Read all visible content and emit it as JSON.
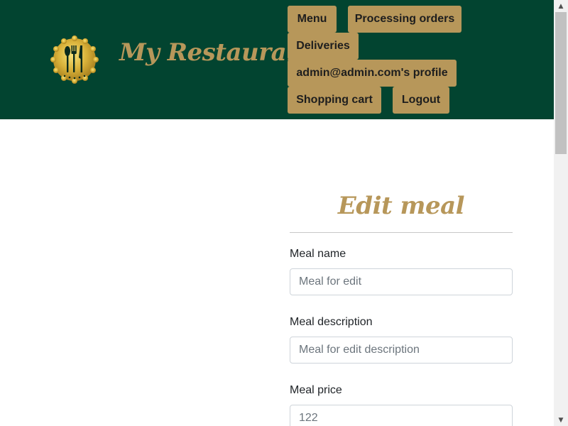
{
  "brand": {
    "name": "My Restaurant"
  },
  "nav": {
    "menu": "Menu",
    "processing_orders": "Processing orders",
    "deliveries": "Deliveries",
    "profile": "admin@admin.com's profile",
    "shopping_cart": "Shopping cart",
    "logout": "Logout"
  },
  "form": {
    "title": "Edit meal",
    "meal_name_label": "Meal name",
    "meal_name_placeholder": "Meal for edit",
    "meal_description_label": "Meal description",
    "meal_description_placeholder": "Meal for edit description",
    "meal_price_label": "Meal price",
    "meal_price_placeholder": "122"
  },
  "colors": {
    "header_bg": "#024430",
    "accent_gold": "#b7975a"
  },
  "icons": {
    "logo": "cutlery-badge-icon",
    "scroll_up": "arrow-up-icon",
    "scroll_down": "arrow-down-icon"
  }
}
